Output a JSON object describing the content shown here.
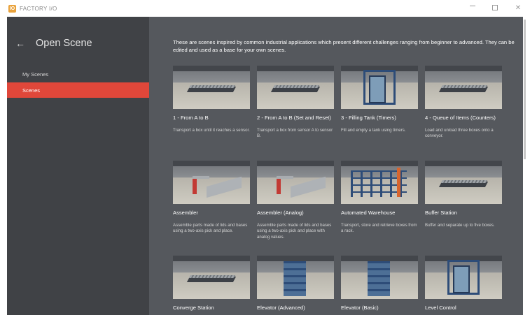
{
  "window": {
    "logo_text": "IO",
    "title": "FACTORY I/O",
    "controls": {
      "minimize": "—",
      "maximize": "□",
      "close": "✕"
    }
  },
  "sidebar": {
    "back_icon": "arrow-left-icon",
    "heading": "Open Scene",
    "items": [
      {
        "label": "My Scenes",
        "active": false
      },
      {
        "label": "Scenes",
        "active": true
      }
    ],
    "active_color": "#e0473a"
  },
  "main": {
    "intro": "These are scenes inspired by common industrial applications which present different challenges ranging from beginner to advanced. They can  be edited and used as a base for your own scenes.",
    "scenes": [
      {
        "title": "1 - From A to B",
        "description": "Transport a box until it reaches a sensor."
      },
      {
        "title": "2 - From A to B (Set and Reset)",
        "description": "Transport a box from sensor A to sensor B."
      },
      {
        "title": "3 - Filling Tank (Timers)",
        "description": "Fill and empty a tank using timers."
      },
      {
        "title": "4 - Queue of Items (Counters)",
        "description": "Load and unload three boxes onto a conveyor."
      },
      {
        "title": "Assembler",
        "description": "Assemble parts made of lids and bases using a two-axis pick and place."
      },
      {
        "title": "Assembler (Analog)",
        "description": "Assemble parts made of lids and bases using a two-axis pick and place with analog values."
      },
      {
        "title": "Automated Warehouse",
        "description": "Transport, store and retrieve boxes from a rack."
      },
      {
        "title": "Buffer Station",
        "description": "Buffer and separate up to five boxes."
      },
      {
        "title": "Converge Station",
        "description": ""
      },
      {
        "title": "Elevator (Advanced)",
        "description": ""
      },
      {
        "title": "Elevator (Basic)",
        "description": ""
      },
      {
        "title": "Level Control",
        "description": ""
      }
    ]
  },
  "colors": {
    "sidebar_bg": "#404246",
    "main_bg": "#55585d",
    "accent": "#e0473a"
  }
}
